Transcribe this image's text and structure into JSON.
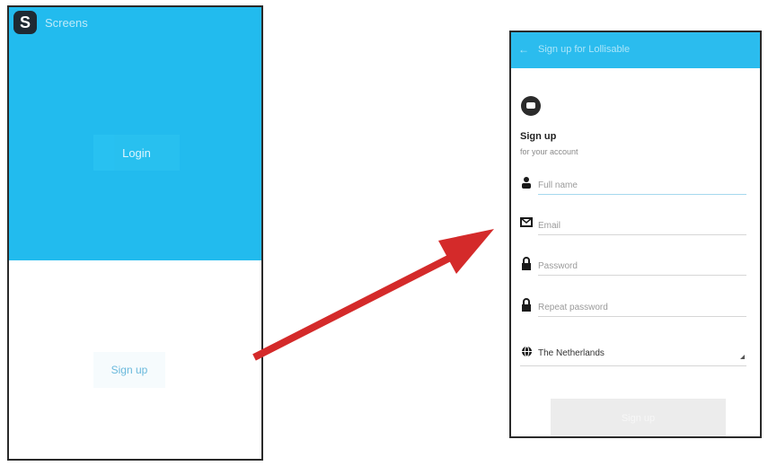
{
  "left_screen": {
    "app_title": "Screens",
    "logo_letter": "S",
    "login_label": "Login",
    "signup_label": "Sign up"
  },
  "right_screen": {
    "back_glyph": "←",
    "title": "Sign up for Lollisable",
    "heading": "Sign up",
    "subheading": "for your account",
    "fields": [
      {
        "icon": "person-icon",
        "placeholder": "Full name"
      },
      {
        "icon": "email-icon",
        "placeholder": "Email"
      },
      {
        "icon": "lock-icon",
        "placeholder": "Password"
      },
      {
        "icon": "lock-icon",
        "placeholder": "Repeat password"
      }
    ],
    "country": "The Netherlands",
    "submit_label": "Sign up"
  },
  "colors": {
    "primary": "#22bbee",
    "arrow": "#d42a2a"
  }
}
